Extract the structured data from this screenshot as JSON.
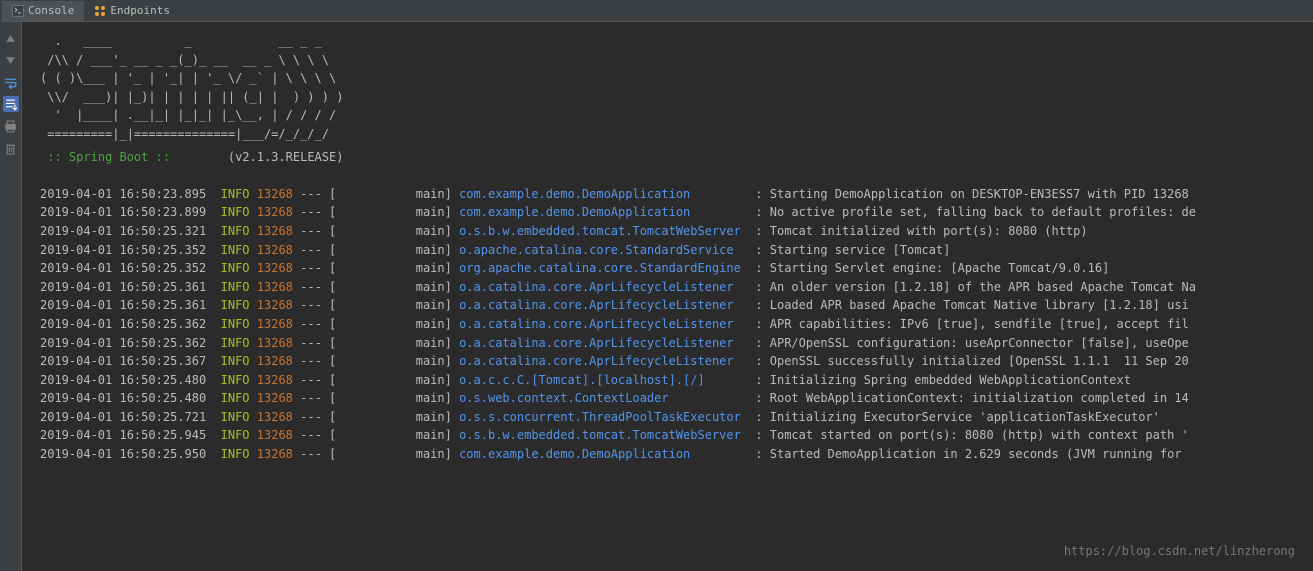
{
  "tabs": [
    {
      "label": "Console",
      "active": true
    },
    {
      "label": "Endpoints",
      "active": false
    }
  ],
  "banner": {
    "ascii": [
      "  .   ____          _            __ _ _",
      " /\\\\ / ___'_ __ _ _(_)_ __  __ _ \\ \\ \\ \\",
      "( ( )\\___ | '_ | '_| | '_ \\/ _` | \\ \\ \\ \\",
      " \\\\/  ___)| |_)| | | | | || (_| |  ) ) ) )",
      "  '  |____| .__|_| |_|_| |_\\__, | / / / /",
      " =========|_|==============|___/=/_/_/_/"
    ],
    "spring_label": " :: Spring Boot :: ",
    "version": "(v2.1.3.RELEASE)"
  },
  "logs": [
    {
      "ts": "2019-04-01 16:50:23.895",
      "level": "INFO",
      "pid": "13268",
      "thread": "main",
      "logger": "com.example.demo.DemoApplication",
      "msg": "Starting DemoApplication on DESKTOP-EN3ESS7 with PID 13268"
    },
    {
      "ts": "2019-04-01 16:50:23.899",
      "level": "INFO",
      "pid": "13268",
      "thread": "main",
      "logger": "com.example.demo.DemoApplication",
      "msg": "No active profile set, falling back to default profiles: de"
    },
    {
      "ts": "2019-04-01 16:50:25.321",
      "level": "INFO",
      "pid": "13268",
      "thread": "main",
      "logger": "o.s.b.w.embedded.tomcat.TomcatWebServer",
      "msg": "Tomcat initialized with port(s): 8080 (http)"
    },
    {
      "ts": "2019-04-01 16:50:25.352",
      "level": "INFO",
      "pid": "13268",
      "thread": "main",
      "logger": "o.apache.catalina.core.StandardService",
      "msg": "Starting service [Tomcat]"
    },
    {
      "ts": "2019-04-01 16:50:25.352",
      "level": "INFO",
      "pid": "13268",
      "thread": "main",
      "logger": "org.apache.catalina.core.StandardEngine",
      "msg": "Starting Servlet engine: [Apache Tomcat/9.0.16]"
    },
    {
      "ts": "2019-04-01 16:50:25.361",
      "level": "INFO",
      "pid": "13268",
      "thread": "main",
      "logger": "o.a.catalina.core.AprLifecycleListener",
      "msg": "An older version [1.2.18] of the APR based Apache Tomcat Na"
    },
    {
      "ts": "2019-04-01 16:50:25.361",
      "level": "INFO",
      "pid": "13268",
      "thread": "main",
      "logger": "o.a.catalina.core.AprLifecycleListener",
      "msg": "Loaded APR based Apache Tomcat Native library [1.2.18] usi"
    },
    {
      "ts": "2019-04-01 16:50:25.362",
      "level": "INFO",
      "pid": "13268",
      "thread": "main",
      "logger": "o.a.catalina.core.AprLifecycleListener",
      "msg": "APR capabilities: IPv6 [true], sendfile [true], accept fil"
    },
    {
      "ts": "2019-04-01 16:50:25.362",
      "level": "INFO",
      "pid": "13268",
      "thread": "main",
      "logger": "o.a.catalina.core.AprLifecycleListener",
      "msg": "APR/OpenSSL configuration: useAprConnector [false], useOpe"
    },
    {
      "ts": "2019-04-01 16:50:25.367",
      "level": "INFO",
      "pid": "13268",
      "thread": "main",
      "logger": "o.a.catalina.core.AprLifecycleListener",
      "msg": "OpenSSL successfully initialized [OpenSSL 1.1.1  11 Sep 20"
    },
    {
      "ts": "2019-04-01 16:50:25.480",
      "level": "INFO",
      "pid": "13268",
      "thread": "main",
      "logger": "o.a.c.c.C.[Tomcat].[localhost].[/]",
      "msg": "Initializing Spring embedded WebApplicationContext"
    },
    {
      "ts": "2019-04-01 16:50:25.480",
      "level": "INFO",
      "pid": "13268",
      "thread": "main",
      "logger": "o.s.web.context.ContextLoader",
      "msg": "Root WebApplicationContext: initialization completed in 14"
    },
    {
      "ts": "2019-04-01 16:50:25.721",
      "level": "INFO",
      "pid": "13268",
      "thread": "main",
      "logger": "o.s.s.concurrent.ThreadPoolTaskExecutor",
      "msg": "Initializing ExecutorService 'applicationTaskExecutor'"
    },
    {
      "ts": "2019-04-01 16:50:25.945",
      "level": "INFO",
      "pid": "13268",
      "thread": "main",
      "logger": "o.s.b.w.embedded.tomcat.TomcatWebServer",
      "msg": "Tomcat started on port(s): 8080 (http) with context path '"
    },
    {
      "ts": "2019-04-01 16:50:25.950",
      "level": "INFO",
      "pid": "13268",
      "thread": "main",
      "logger": "com.example.demo.DemoApplication",
      "msg": "Started DemoApplication in 2.629 seconds (JVM running for "
    }
  ],
  "watermark": "https://blog.csdn.net/linzherong"
}
